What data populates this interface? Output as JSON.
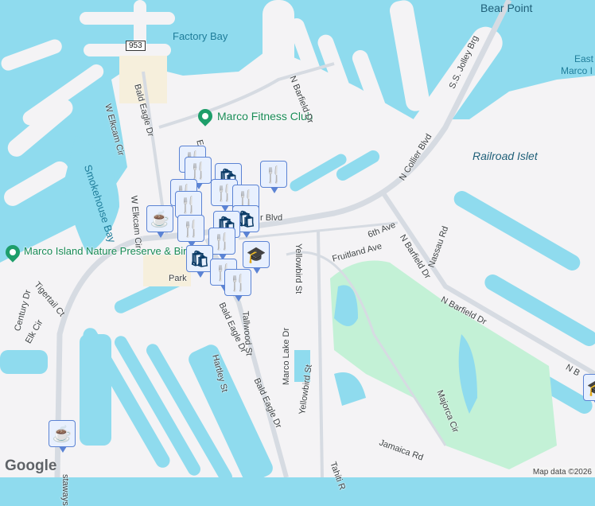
{
  "map": {
    "route_shield": "953",
    "water_labels": {
      "factory_bay": "Factory Bay",
      "smokehouse_bay": "Smokehouse Bay",
      "bear_point": "Bear Point",
      "east_marco_1": "East",
      "east_marco_2": "Marco I",
      "railroad_islet": "Railroad Islet"
    },
    "pois": {
      "fitness": "Marco Fitness Club",
      "nature_preserve": "Marco Island Nature Preserve & Bird..."
    },
    "streets": {
      "n_barfield_top": "N Barfield Dr",
      "n_barfield_mid": "N Barfield Dr",
      "n_barfield_right": "N Barfield Dr",
      "n_barfield_far": "N B",
      "jolley": "S.S. Jolley Brg",
      "n_collier": "N Collier Blvd",
      "collier_partial": "r Blvd",
      "w_elkcam_1": "W Elkcam Cir",
      "w_elkcam_2": "W Elkcam Cir",
      "bald_eagle_1": "Bald Eagle Dr",
      "bald_eagle_2": "Bald Eagle Dr",
      "bald_eagle_3": "Bald Eagle Dr",
      "e_elkcam": "E E",
      "sixth_ave": "6th Ave",
      "fruitland": "Fruitland Ave",
      "nassau": "Nassau Rd",
      "yellowbird_1": "Yellowbird St",
      "yellowbird_2": "Yellowbird St",
      "tallwood": "Tallwood St",
      "marco_lake": "Marco Lake Dr",
      "hartley": "Hartley St",
      "park": "Park",
      "tigertail": "Tigertail Ct",
      "century": "Century Dr",
      "elk_cir": "Elk Cir",
      "majorca": "Majorca Cir",
      "jamaica": "Jamaica Rd",
      "tahiti": "Tahiti R",
      "castaways": "staways"
    },
    "markers": [
      {
        "type": "restaurant",
        "glyph": "🍴"
      },
      {
        "type": "restaurant",
        "glyph": "🍴"
      },
      {
        "type": "shopping",
        "glyph": "🛍"
      },
      {
        "type": "restaurant",
        "glyph": "🍴"
      },
      {
        "type": "restaurant",
        "glyph": "🍴"
      },
      {
        "type": "restaurant",
        "glyph": "🍴"
      },
      {
        "type": "shopping",
        "glyph": "🛍"
      },
      {
        "type": "restaurant",
        "glyph": "🍴"
      },
      {
        "type": "cafe",
        "glyph": "☕"
      },
      {
        "type": "restaurant",
        "glyph": "🍴"
      },
      {
        "type": "restaurant",
        "glyph": "🍴"
      },
      {
        "type": "shopping",
        "glyph": "🛍"
      },
      {
        "type": "school",
        "glyph": "🎓"
      },
      {
        "type": "restaurant",
        "glyph": "🍴"
      },
      {
        "type": "restaurant",
        "glyph": "🍴"
      },
      {
        "type": "cafe",
        "glyph": "☕"
      },
      {
        "type": "school",
        "glyph": "🎓"
      }
    ],
    "logo": "Google",
    "attribution": "Map data ©2026",
    "colors": {
      "water": "#8fdbee",
      "land": "#f4f3f5",
      "park": "#c3f1d6",
      "marker_icon": "#0b3b66"
    }
  }
}
